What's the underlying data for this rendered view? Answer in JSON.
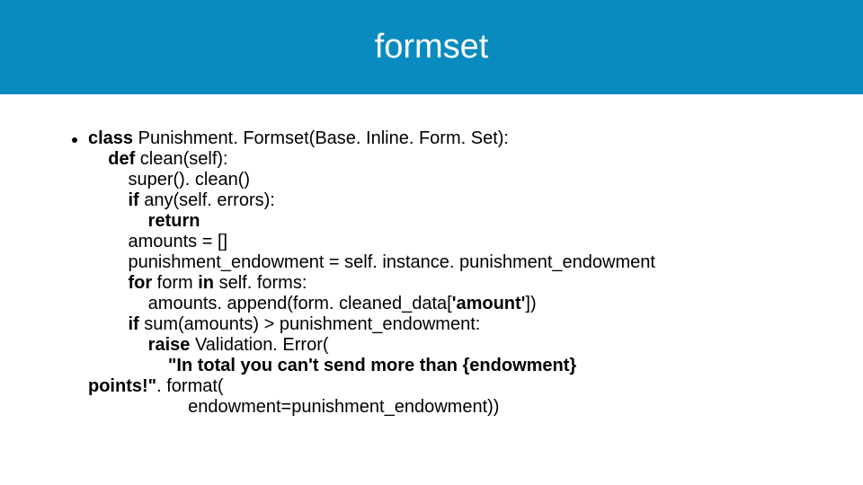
{
  "slide": {
    "title": "formset",
    "code": {
      "l1a": "class ",
      "l1b": "Punishment. Formset(Base. Inline. Form. Set):",
      "l2a": "    def ",
      "l2b": "clean(self):",
      "l3": "        super(). clean()",
      "l4a": "        if ",
      "l4b": "any(self. errors):",
      "l5": "            return",
      "l6": "        amounts = []",
      "l7": "        punishment_endowment = self. instance. punishment_endowment",
      "l8a": "        for ",
      "l8b": "form ",
      "l8c": "in ",
      "l8d": "self. forms:",
      "l9a": "            amounts. append(form. cleaned_data[",
      "l9b": "'amount'",
      "l9c": "])",
      "l10a": "        if ",
      "l10b": "sum(amounts) > punishment_endowment:",
      "l11a": "            raise ",
      "l11b": "Validation. Error(",
      "l12a": "                \"In total you can't send more than {endowment}",
      "l12b": "points!\"",
      "l12c": ". format(",
      "l13": "                    endowment=punishment_endowment))"
    }
  }
}
